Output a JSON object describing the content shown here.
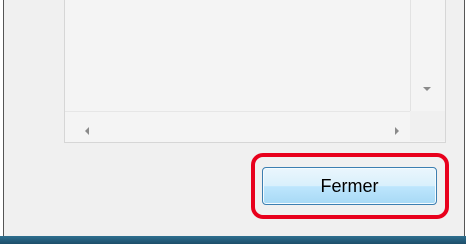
{
  "dialog": {
    "close_button_label": "Fermer"
  },
  "colors": {
    "highlight": "#e8001c",
    "button_border": "#3c7fb1",
    "taskbar": "#1d4e6a"
  },
  "icons": [
    "arrow-down-icon",
    "arrow-left-icon",
    "arrow-right-icon"
  ]
}
